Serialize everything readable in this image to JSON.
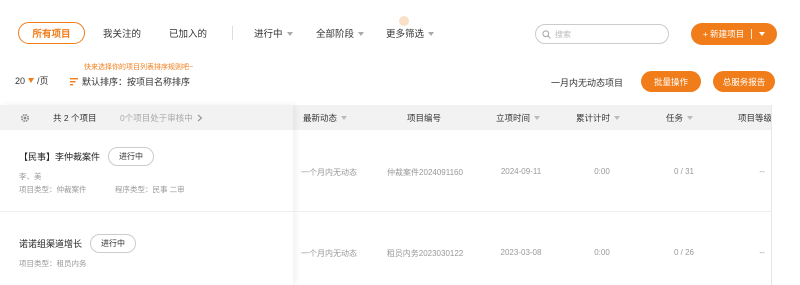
{
  "filters": {
    "tabs": [
      "所有项目",
      "我关注的",
      "已加入的"
    ],
    "dropdowns": [
      "进行中",
      "全部阶段",
      "更多筛选"
    ]
  },
  "search": {
    "placeholder": "搜索"
  },
  "new_button": {
    "label": "+ 新建项目"
  },
  "toolbar": {
    "hint": "快来选择你的项目列表排序规则吧~",
    "page_size": "20",
    "page_unit": "/页",
    "sort_label": "默认排序：按项目名称排序",
    "inactive_label": "一月内无动态项目",
    "batch_button": "批量操作",
    "report_button": "总服务报告"
  },
  "table": {
    "summary": "共 2 个项目",
    "review_note": "0个项目处于审核中",
    "columns": [
      "最新动态",
      "项目编号",
      "立项时间",
      "累计计时",
      "任务",
      "项目等级"
    ],
    "rows": [
      {
        "title": "【民事】李仲裁案件",
        "status": "进行中",
        "people": "李、美",
        "type": "项目类型：仲裁案件",
        "procedure": "程序类型：民事 二审",
        "activity": "一个月内无动态",
        "code": "仲裁案件2024091160",
        "date": "2024-09-11",
        "time": "0:00",
        "tasks": "0 / 31",
        "level": "--"
      },
      {
        "title": "诺诺组渠道增长",
        "status": "进行中",
        "type": "项目类型：租员内务",
        "activity": "一个月内无动态",
        "code": "租员内务2023030122",
        "date": "2023-03-08",
        "time": "0:00",
        "tasks": "0 / 26",
        "level": "--"
      }
    ]
  }
}
